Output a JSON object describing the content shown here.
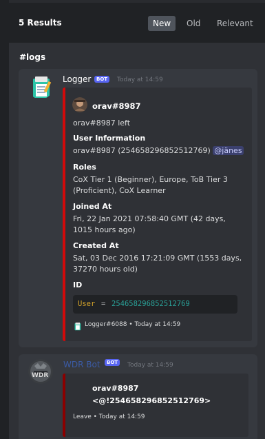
{
  "header": {
    "results_label": "5 Results",
    "tabs": [
      {
        "label": "New",
        "active": true
      },
      {
        "label": "Old",
        "active": false
      },
      {
        "label": "Relevant",
        "active": false
      }
    ]
  },
  "channel": "#logs",
  "messages": [
    {
      "author": "Logger",
      "bot_tag": "BOT",
      "timestamp": "Today at 14:59",
      "avatar_icon": "notepad-icon",
      "embed": {
        "accent_color": "#d20a0a",
        "author_name": "orav#8987",
        "description": "orav#8987 left",
        "fields": [
          {
            "name": "User Information",
            "value_prefix": "orav#8987 (254658296852512769)",
            "mention": "@jänes"
          },
          {
            "name": "Roles",
            "lines": [
              "CoX Tier 1 (Beginner), Europe, ToB Tier 3",
              "(Proficient), CoX Learner"
            ]
          },
          {
            "name": "Joined At",
            "lines": [
              "Fri, 22 Jan 2021 07:58:40 GMT (42 days,",
              "1015 hours ago)"
            ]
          },
          {
            "name": "Created At",
            "lines": [
              "Sat, 03 Dec 2016 17:21:09 GMT (1553 days,",
              "37270 hours old)"
            ]
          },
          {
            "name": "ID",
            "code_key": "User",
            "code_op": "=",
            "code_value": "254658296852512769"
          }
        ],
        "footer": "Logger#6088 • Today at 14:59"
      }
    },
    {
      "author": "WDR Bot",
      "bot_tag": "BOT",
      "timestamp": "Today at 14:59",
      "avatar_text": "WDR",
      "embed": {
        "accent_color": "#8b0000",
        "lines": [
          "orav#8987",
          "<@!254658296852512769>"
        ],
        "footer": "Leave • Today at 14:59"
      }
    }
  ],
  "colors": {
    "background": "#2f3136",
    "header": "#202225",
    "card": "#36393f",
    "logger_name": "#ffffff",
    "wdr_name": "#3b5ba5",
    "mention": "#c9cdfb",
    "code_key": "#d6a42a",
    "code_value": "#2aa198"
  }
}
